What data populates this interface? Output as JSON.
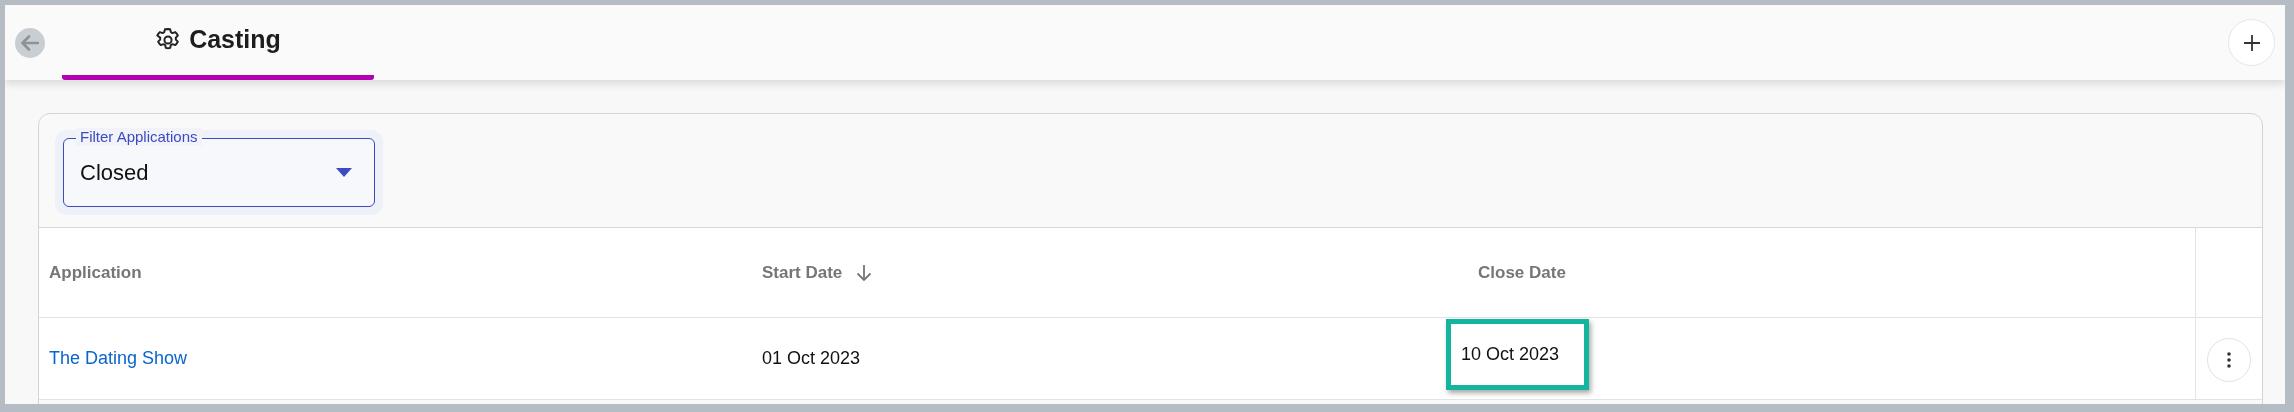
{
  "tabs": [
    {
      "label": "Casting",
      "selected": true
    }
  ],
  "filter": {
    "label": "Filter Applications",
    "value": "Closed"
  },
  "table": {
    "columns": [
      {
        "label": "Application",
        "sorted": false
      },
      {
        "label": "Start Date",
        "sorted": true
      },
      {
        "label": "Close Date",
        "sorted": false
      }
    ],
    "rows": [
      {
        "application": "The Dating Show",
        "start_date": "01 Oct 2023",
        "close_date": "10 Oct 2023",
        "close_date_highlighted": true
      }
    ]
  }
}
